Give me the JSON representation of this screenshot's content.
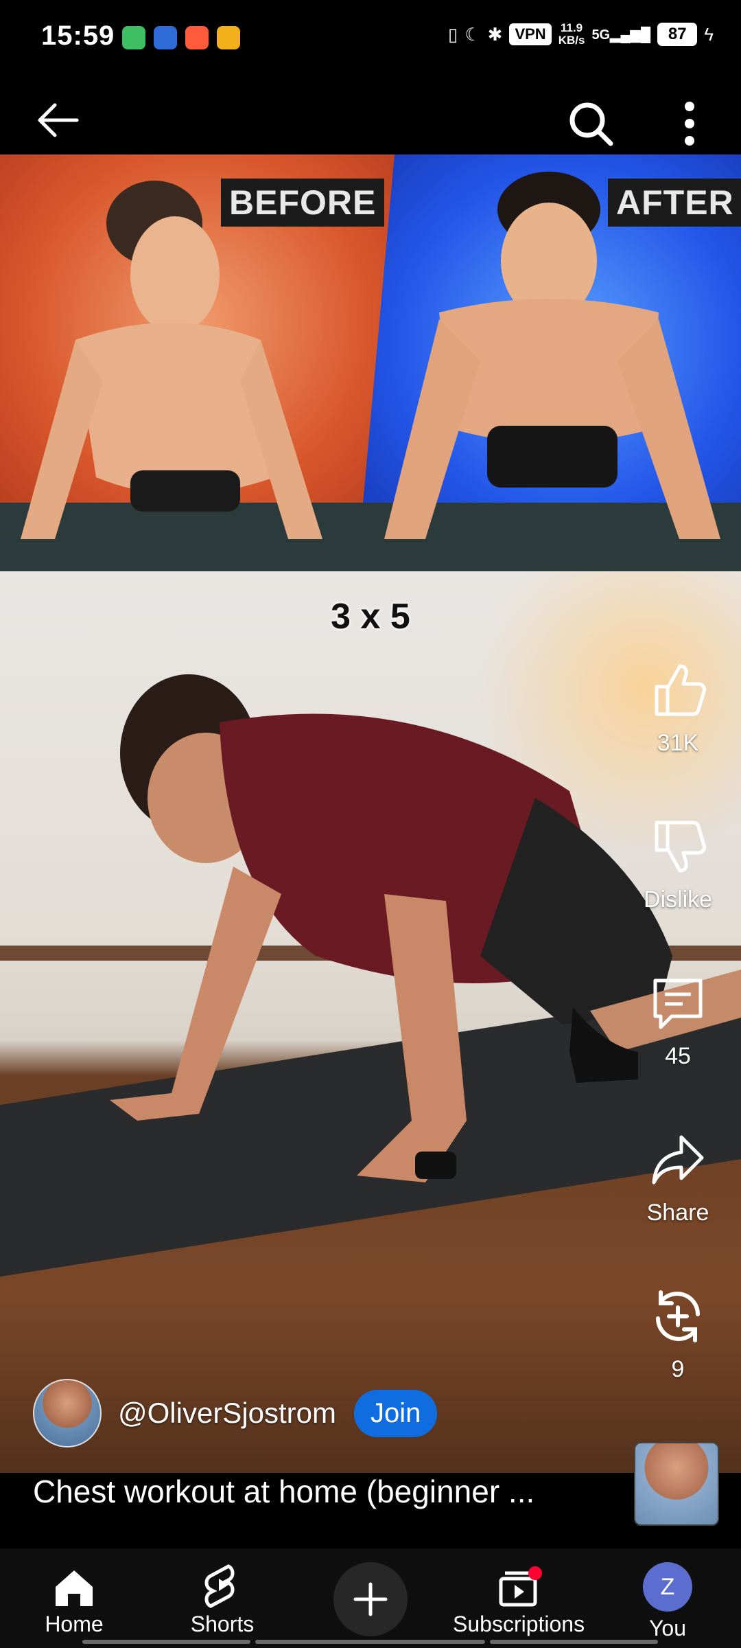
{
  "status": {
    "time": "15:59",
    "vpn": "VPN",
    "speed_value": "11.9",
    "speed_unit": "KB/s",
    "network": "5G",
    "battery": "87",
    "app_icon_colors": [
      "#3fbf63",
      "#2f6bd6",
      "#ff5a3c",
      "#f2b11b"
    ]
  },
  "thumbnail": {
    "before_label": "BEFORE",
    "after_label": "AFTER"
  },
  "video": {
    "overlay_text": "3 x 5"
  },
  "actions": {
    "like_count": "31K",
    "dislike_label": "Dislike",
    "comment_count": "45",
    "share_label": "Share",
    "remix_count": "9"
  },
  "channel": {
    "name": "@OliverSjostrom",
    "join_label": "Join"
  },
  "title": "Chest workout at home (beginner  ...",
  "nav": {
    "home": "Home",
    "shorts": "Shorts",
    "subscriptions": "Subscriptions",
    "you": "You",
    "you_initial": "Z"
  },
  "colors": {
    "join": "#0f6de0",
    "notification_dot": "#ff0033",
    "you_avatar": "#5b6ecf"
  }
}
